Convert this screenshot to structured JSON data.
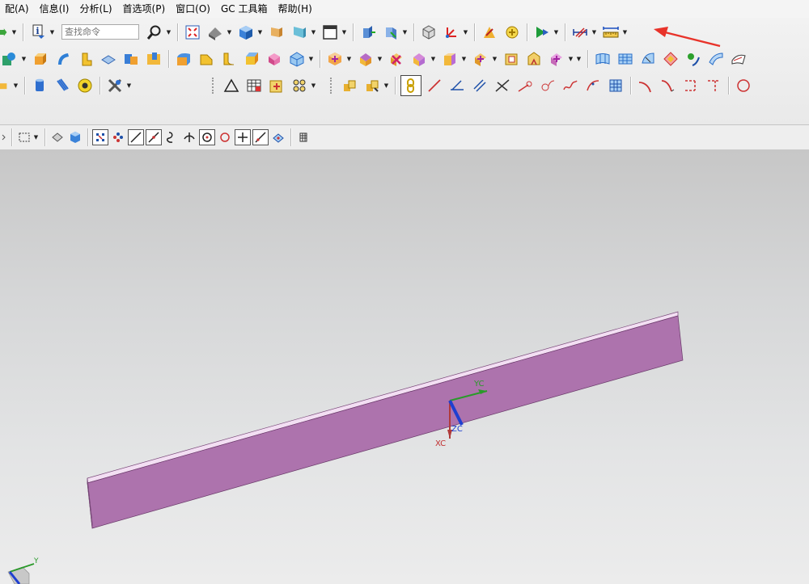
{
  "menu": {
    "items": [
      "配(A)",
      "信息(I)",
      "分析(L)",
      "首选项(P)",
      "窗口(O)",
      "GC 工具箱",
      "帮助(H)"
    ]
  },
  "toolbar": {
    "command_search_placeholder": "查找命令"
  },
  "viewport": {
    "axes": {
      "x": "XC",
      "y": "YC",
      "z": "ZC"
    },
    "corner_triad_y": "Y"
  },
  "colors": {
    "part_face": "#ad73ad",
    "annotation_arrow": "#e8332a"
  }
}
